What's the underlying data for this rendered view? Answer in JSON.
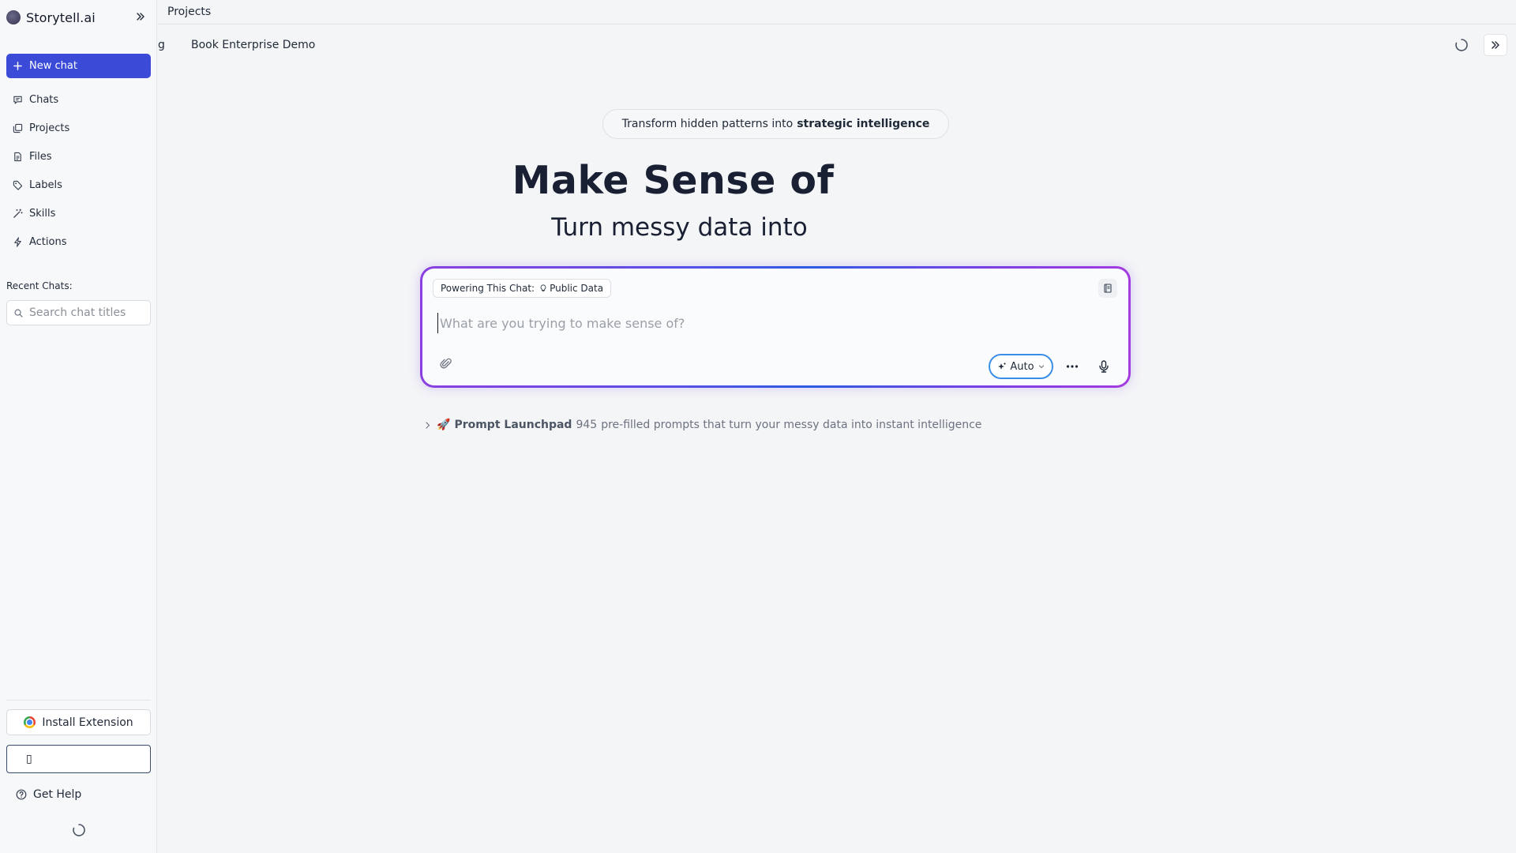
{
  "app": {
    "brand": "Storytell.ai"
  },
  "sidebar": {
    "new_chat": "New chat",
    "items": [
      {
        "label": "Chats",
        "icon": "chat-icon"
      },
      {
        "label": "Projects",
        "icon": "projects-icon"
      },
      {
        "label": "Files",
        "icon": "file-icon"
      },
      {
        "label": "Labels",
        "icon": "tag-icon"
      },
      {
        "label": "Skills",
        "icon": "wand-icon"
      },
      {
        "label": "Actions",
        "icon": "bolt-icon"
      }
    ],
    "recent_label": "Recent Chats:",
    "search_placeholder": "Search chat titles",
    "install_extension": "Install Extension",
    "focus_box_glyph": "▯",
    "get_help": "Get Help"
  },
  "topbar": {
    "breadcrumb": "Projects"
  },
  "tabs": {
    "truncated": "g",
    "title": "Book Enterprise Demo"
  },
  "hero": {
    "pill_prefix": "Transform hidden patterns into",
    "pill_bold": "strategic intelligence",
    "title": "Make Sense of",
    "subtitle": "Turn messy data into"
  },
  "composer": {
    "powering_label": "Powering This Chat:",
    "powering_value": "Public Data",
    "placeholder": "What are you trying to make sense of?",
    "model_label": "Auto"
  },
  "launchpad": {
    "title": "Prompt Launchpad",
    "count": "945",
    "description": "pre-filled prompts that turn your messy data into instant intelligence"
  },
  "colors": {
    "accent": "#3b4bd8",
    "glow_purple": "#8b3fe0",
    "glow_blue": "#2d5be3",
    "auto_border": "#3b8ee8"
  }
}
